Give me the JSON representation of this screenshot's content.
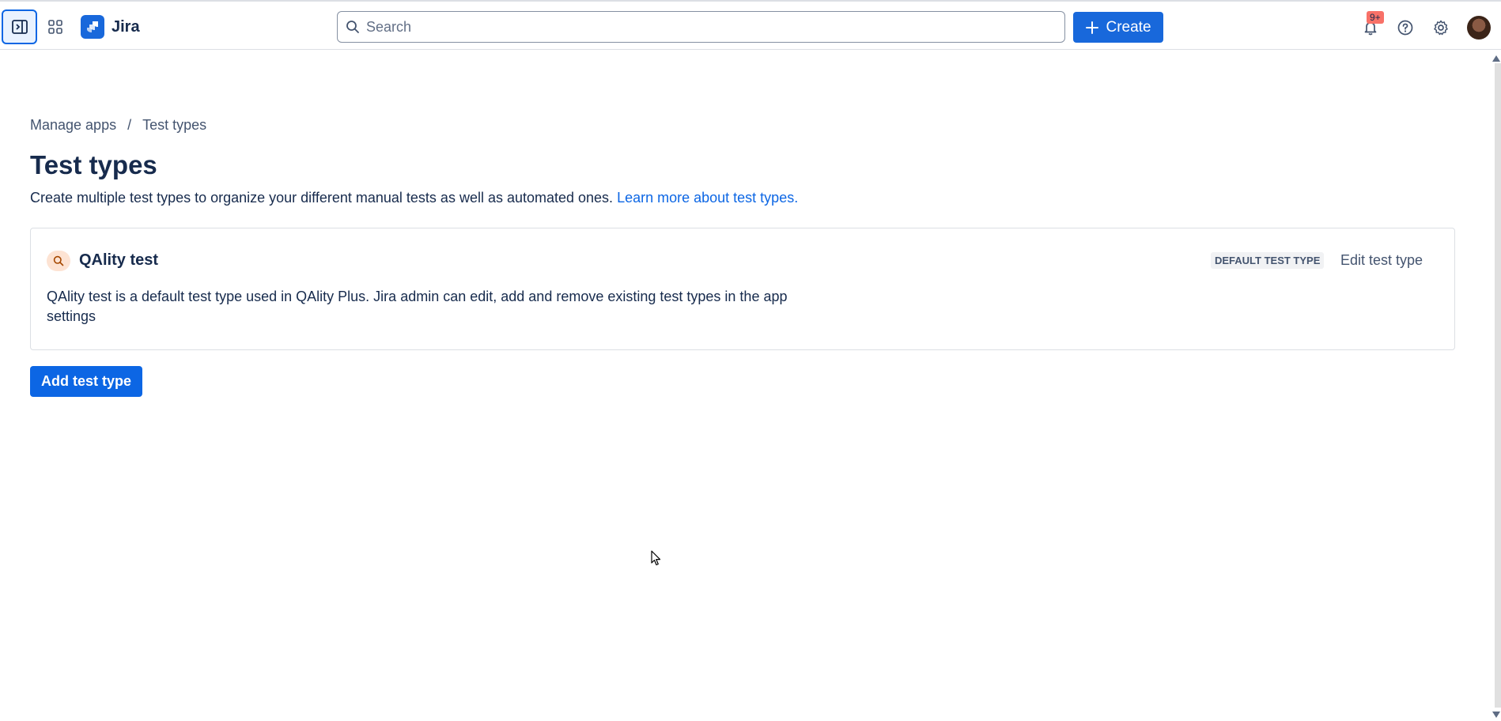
{
  "topbar": {
    "app_name": "Jira",
    "search_placeholder": "Search",
    "create_label": "Create",
    "notifications_count": "9+"
  },
  "breadcrumb": {
    "items": [
      "Manage apps",
      "Test types"
    ],
    "separator": "/"
  },
  "page": {
    "title": "Test types",
    "intro_text": "Create multiple test types to organize your different manual tests as well as automated ones.",
    "learn_more": "Learn more about test types."
  },
  "test_type_card": {
    "name": "QAlity test",
    "badge": "DEFAULT TEST TYPE",
    "edit_label": "Edit test type",
    "description": "QAlity test is a default test type used in QAlity Plus. Jira admin can edit, add and remove existing test types in the app settings"
  },
  "actions": {
    "add_label": "Add test type"
  },
  "colors": {
    "brand_blue": "#0c66e4",
    "badge_red": "#f87168"
  }
}
